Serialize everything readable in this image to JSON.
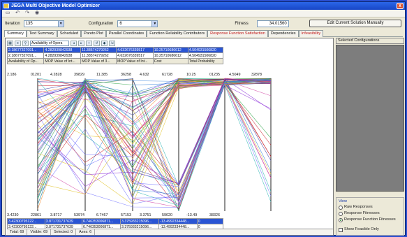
{
  "window": {
    "title": "JEGA Multi Objective Model Optimizer",
    "close": "x"
  },
  "toolbar": {
    "icons": [
      "save-icon",
      "undo-icon",
      "redo-icon",
      "help-icon"
    ],
    "glyphs": [
      "▭",
      "↶",
      "↷",
      "◉"
    ]
  },
  "controls": {
    "iteration_label": "Iteration",
    "iteration_value": "135",
    "configuration_label": "Configuration",
    "configuration_value": "6",
    "fitness_label": "Fitness",
    "fitness_value": "34.01560",
    "edit_button": "Edit Current Solution Manually"
  },
  "tabs": [
    {
      "label": "Summary",
      "red": false,
      "active": true
    },
    {
      "label": "Text Summary",
      "red": false
    },
    {
      "label": "Scheduled",
      "red": false
    },
    {
      "label": "Pareto Plot",
      "red": false
    },
    {
      "label": "Parallel Coordinates",
      "red": false
    },
    {
      "label": "Function Reliability Contributors",
      "red": false
    },
    {
      "label": "Response Function Satisfaction",
      "red": true
    },
    {
      "label": "Dependencies",
      "red": false
    },
    {
      "label": "Infeasibility",
      "red": true
    }
  ],
  "plot_toolbar": {
    "selector": "Availability of Opera"
  },
  "top_grid": {
    "rows": [
      [
        "2.18677327091...",
        "4.282939842938",
        "11.38574279262",
        "4.632676339517",
        "10.25710686612",
        "4.504931506820"
      ],
      [
        "2.18677327091...",
        "4.282939842938",
        "11.38574279262",
        "4.632676339517",
        "10.25710686612",
        "4.504931506820"
      ]
    ],
    "headers": [
      "Availability of Op...",
      "MOP Value of Int...",
      "MOP Value of 3...",
      "MOP Value of Int...",
      "Cost",
      "Total Probability"
    ]
  },
  "axis_top": [
    "2.186",
    "01201",
    "4.2828",
    "39829",
    "11.385",
    "36258",
    "4.632",
    "61728",
    "10.25",
    "01235",
    "4.5049",
    "32878"
  ],
  "axis_bottom": [
    "3.4230",
    "22861",
    "3.8717",
    "53974",
    "6.7467",
    "57153",
    "3.3751",
    "59620",
    "-13.49",
    "38326",
    ""
  ],
  "bottom_grid": {
    "rows": [
      [
        "3.42300795122...",
        "3.871731737639",
        "6.746353006871...",
        "3.375933215096...",
        "-13.4992334448...",
        "0"
      ],
      [
        "3.42300795122...",
        "3.871731737639",
        "6.746353006871...",
        "3.375933215096...",
        "-13.4992334448...",
        "0"
      ]
    ]
  },
  "status": {
    "total": "Total:  69",
    "visible": "Visible:  69",
    "selected": "Selected:  0",
    "axes": "Axes:       6"
  },
  "side": {
    "header": "Selected Configurations",
    "view_title": "View",
    "options": [
      "Raw Responses",
      "Response Fitnesses",
      "Response Function Fitnesses"
    ],
    "selected_option": 2,
    "show_feasible": "Show Feasible Only"
  },
  "colors": {
    "title": "#1746c6",
    "selection": "#2a55d4",
    "side_panel": "#7d7d7d",
    "tab_red": "#c01818"
  }
}
